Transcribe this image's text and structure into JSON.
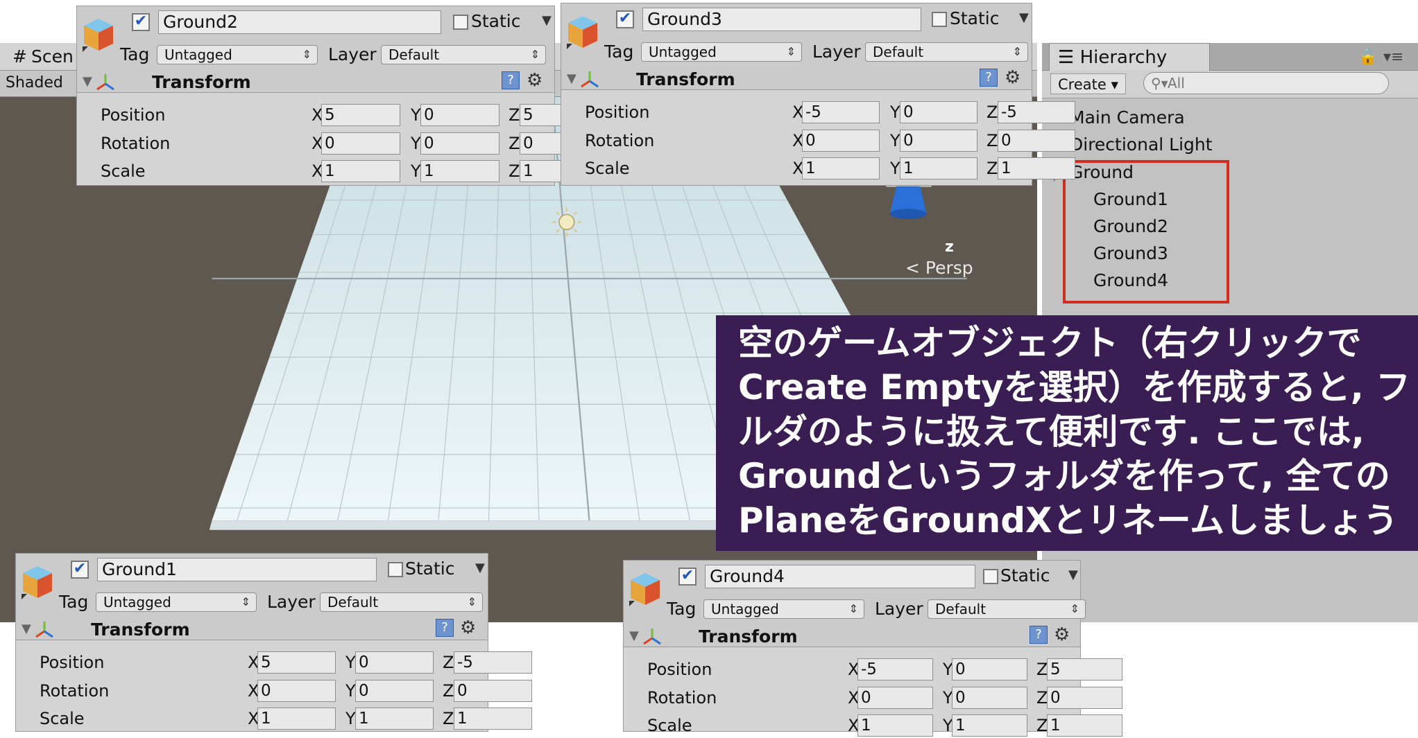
{
  "scene": {
    "tab_label": "Scen",
    "tab_icon": "grid-icon",
    "render_mode": "Shaded",
    "gizmo_axis_label": "z",
    "projection_label": "Persp"
  },
  "hierarchy": {
    "tab_label": "Hierarchy",
    "create_label": "Create",
    "search_placeholder": "All",
    "items": [
      {
        "label": "Main Camera"
      },
      {
        "label": "Directional Light"
      },
      {
        "label": "Ground"
      },
      {
        "label": "Ground1"
      },
      {
        "label": "Ground2"
      },
      {
        "label": "Ground3"
      },
      {
        "label": "Ground4"
      }
    ]
  },
  "caption_lines": [
    "空のゲームオブジェクト（右クリックで",
    "Create Emptyを選択）を作成すると, フ",
    "ルダのように扱えて便利です. ここでは,",
    "Groundというフォルダを作って, 全ての",
    "PlaneをGroundXとリネームしましょう"
  ],
  "labels": {
    "static": "Static",
    "tag": "Tag",
    "layer": "Layer",
    "tag_value": "Untagged",
    "layer_value": "Default",
    "transform": "Transform",
    "position": "Position",
    "rotation": "Rotation",
    "scale": "Scale",
    "x": "X",
    "y": "Y",
    "z": "Z"
  },
  "inspectors": [
    {
      "name": "Ground2",
      "position": [
        "5",
        "0",
        "5"
      ],
      "rotation": [
        "0",
        "0",
        "0"
      ],
      "scale": [
        "1",
        "1",
        "1"
      ]
    },
    {
      "name": "Ground3",
      "position": [
        "-5",
        "0",
        "-5"
      ],
      "rotation": [
        "0",
        "0",
        "0"
      ],
      "scale": [
        "1",
        "1",
        "1"
      ]
    },
    {
      "name": "Ground1",
      "position": [
        "5",
        "0",
        "-5"
      ],
      "rotation": [
        "0",
        "0",
        "0"
      ],
      "scale": [
        "1",
        "1",
        "1"
      ]
    },
    {
      "name": "Ground4",
      "position": [
        "-5",
        "0",
        "5"
      ],
      "rotation": [
        "0",
        "0",
        "0"
      ],
      "scale": [
        "1",
        "1",
        "1"
      ]
    }
  ],
  "colors": {
    "highlight_box": "#d12c1d",
    "caption_bg": "#3a1d52",
    "scene_bg": "#5f5850"
  }
}
